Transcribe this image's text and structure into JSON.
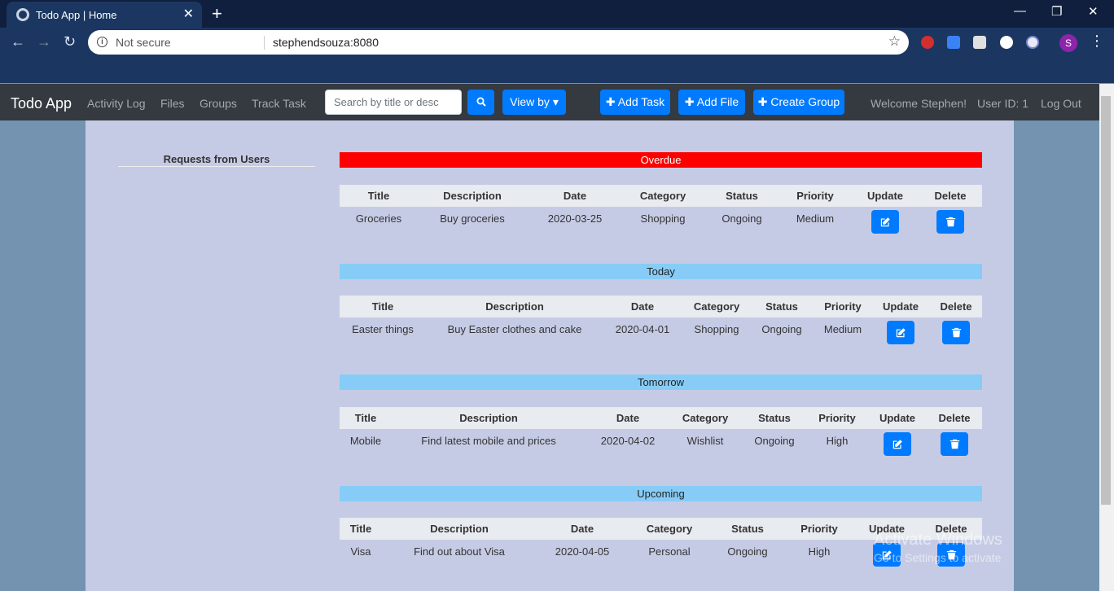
{
  "browser": {
    "tab_title": "Todo App | Home",
    "security_label": "Not secure",
    "url": "stephendsouza:8080",
    "profile_initial": "S"
  },
  "nav": {
    "brand": "Todo App",
    "links": [
      "Activity Log",
      "Files",
      "Groups",
      "Track Task"
    ],
    "search_placeholder": "Search by title or desc",
    "view_by_label": "View by",
    "add_task_label": "Add Task",
    "add_file_label": "Add File",
    "create_group_label": "Create Group",
    "welcome": "Welcome Stephen!",
    "user_id": "User ID: 1",
    "logout": "Log Out"
  },
  "sidebar": {
    "title": "Requests from Users"
  },
  "table_headers": [
    "Title",
    "Description",
    "Date",
    "Category",
    "Status",
    "Priority",
    "Update",
    "Delete"
  ],
  "sections": [
    {
      "name": "Overdue",
      "color": "#ff0000",
      "rows": [
        {
          "title": "Groceries",
          "description": "Buy groceries",
          "date": "2020-03-25",
          "category": "Shopping",
          "status": "Ongoing",
          "priority": "Medium"
        }
      ]
    },
    {
      "name": "Today",
      "color": "#87ccf7",
      "rows": [
        {
          "title": "Easter things",
          "description": "Buy Easter clothes and cake",
          "date": "2020-04-01",
          "category": "Shopping",
          "status": "Ongoing",
          "priority": "Medium"
        }
      ]
    },
    {
      "name": "Tomorrow",
      "color": "#87ccf7",
      "rows": [
        {
          "title": "Mobile",
          "description": "Find latest mobile and prices",
          "date": "2020-04-02",
          "category": "Wishlist",
          "status": "Ongoing",
          "priority": "High"
        }
      ]
    },
    {
      "name": "Upcoming",
      "color": "#87ccf7",
      "rows": [
        {
          "title": "Visa",
          "description": "Find out about Visa",
          "date": "2020-04-05",
          "category": "Personal",
          "status": "Ongoing",
          "priority": "High"
        }
      ]
    }
  ],
  "os_watermark": {
    "line1": "Activate Windows",
    "line2": "Go to Settings to activate"
  },
  "colors": {
    "accent": "#007bff",
    "navbar": "#343a40",
    "page_bg": "#c6cbe5",
    "overdue": "#ff0000",
    "section": "#87ccf7"
  }
}
